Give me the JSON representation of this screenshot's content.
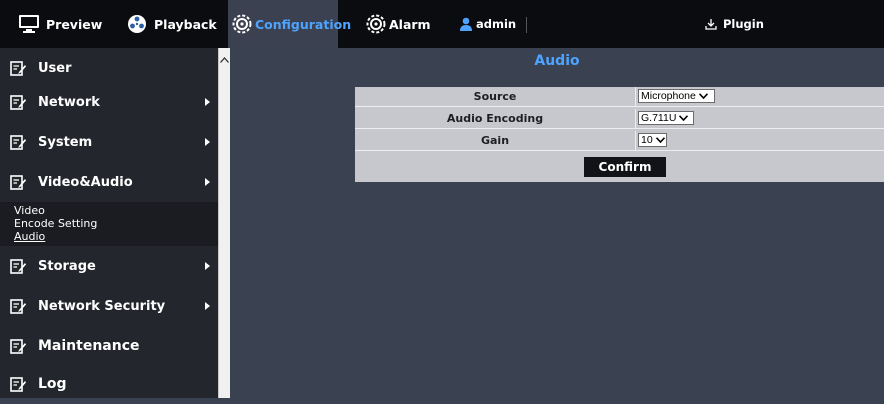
{
  "topbar": {
    "tabs": [
      {
        "label": "Preview",
        "icon": "monitor-icon"
      },
      {
        "label": "Playback",
        "icon": "film-reel-icon"
      },
      {
        "label": "Configuration",
        "icon": "gear-icon",
        "active": true
      },
      {
        "label": "Alarm",
        "icon": "gear-icon"
      }
    ],
    "user": "admin",
    "user_icon": "user-icon",
    "plugin": "Plugin",
    "plugin_icon": "download-icon",
    "active_color": "#4ea3ff"
  },
  "sidebar": {
    "items": [
      {
        "label": "User",
        "has_arrow": false
      },
      {
        "label": "Network",
        "has_arrow": true
      },
      {
        "label": "System",
        "has_arrow": true
      },
      {
        "label": "Video&Audio",
        "has_arrow": true,
        "expanded": true
      },
      {
        "label": "Storage",
        "has_arrow": true
      },
      {
        "label": "Network Security",
        "has_arrow": true
      },
      {
        "label": "Maintenance",
        "has_arrow": false
      },
      {
        "label": "Log",
        "has_arrow": false
      }
    ],
    "subitems": [
      {
        "label": "Video"
      },
      {
        "label": "Encode Setting"
      },
      {
        "label": "Audio",
        "active": true
      }
    ],
    "item_icon": "edit-icon"
  },
  "main": {
    "title": "Audio",
    "rows": [
      {
        "label": "Source",
        "value": "Microphone"
      },
      {
        "label": "Audio Encoding",
        "value": "G.711U"
      },
      {
        "label": "Gain",
        "value": "10"
      }
    ],
    "confirm_label": "Confirm"
  }
}
